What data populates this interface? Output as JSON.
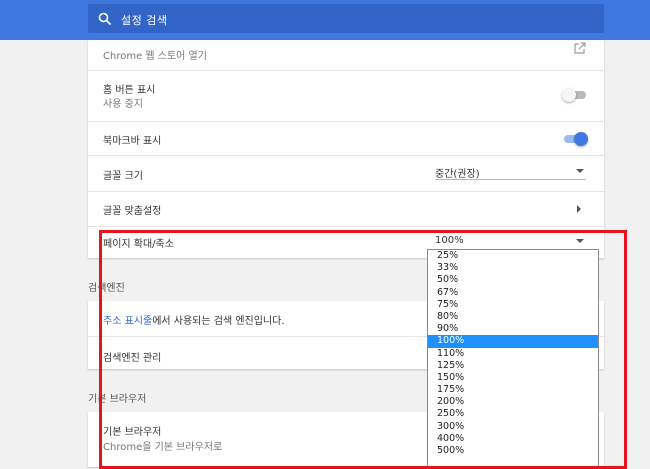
{
  "search": {
    "placeholder": "설정 검색"
  },
  "appearance": {
    "web_store": {
      "sub": "Chrome 웹 스토어 열기"
    },
    "home_button": {
      "label": "홈 버튼 표시",
      "sub": "사용 중지"
    },
    "bookmarks_bar": {
      "label": "북마크바 표시"
    },
    "font_size": {
      "label": "글꼴 크기",
      "value": "중간(권장)"
    },
    "customize_fonts": {
      "label": "글꼴 맞춤설정"
    },
    "page_zoom": {
      "label": "페이지 확대/축소",
      "value": "100%"
    }
  },
  "search_engine": {
    "heading": "검색엔진",
    "address_bar_link": "주소 표시줄",
    "address_bar_text": "에서 사용되는 검색 엔진입니다.",
    "manage": "검색엔진 관리"
  },
  "default_browser": {
    "heading": "기본 브라우저",
    "label": "기본 브라우저",
    "sub": "Chrome을 기본 브라우저로"
  },
  "zoom_options": [
    "25%",
    "33%",
    "50%",
    "67%",
    "75%",
    "80%",
    "90%",
    "100%",
    "110%",
    "125%",
    "150%",
    "175%",
    "200%",
    "250%",
    "300%",
    "400%",
    "500%"
  ],
  "zoom_selected": "100%",
  "colors": {
    "accent": "#3f78e0",
    "highlight": "#e8141c",
    "selection": "#1e90ff"
  }
}
